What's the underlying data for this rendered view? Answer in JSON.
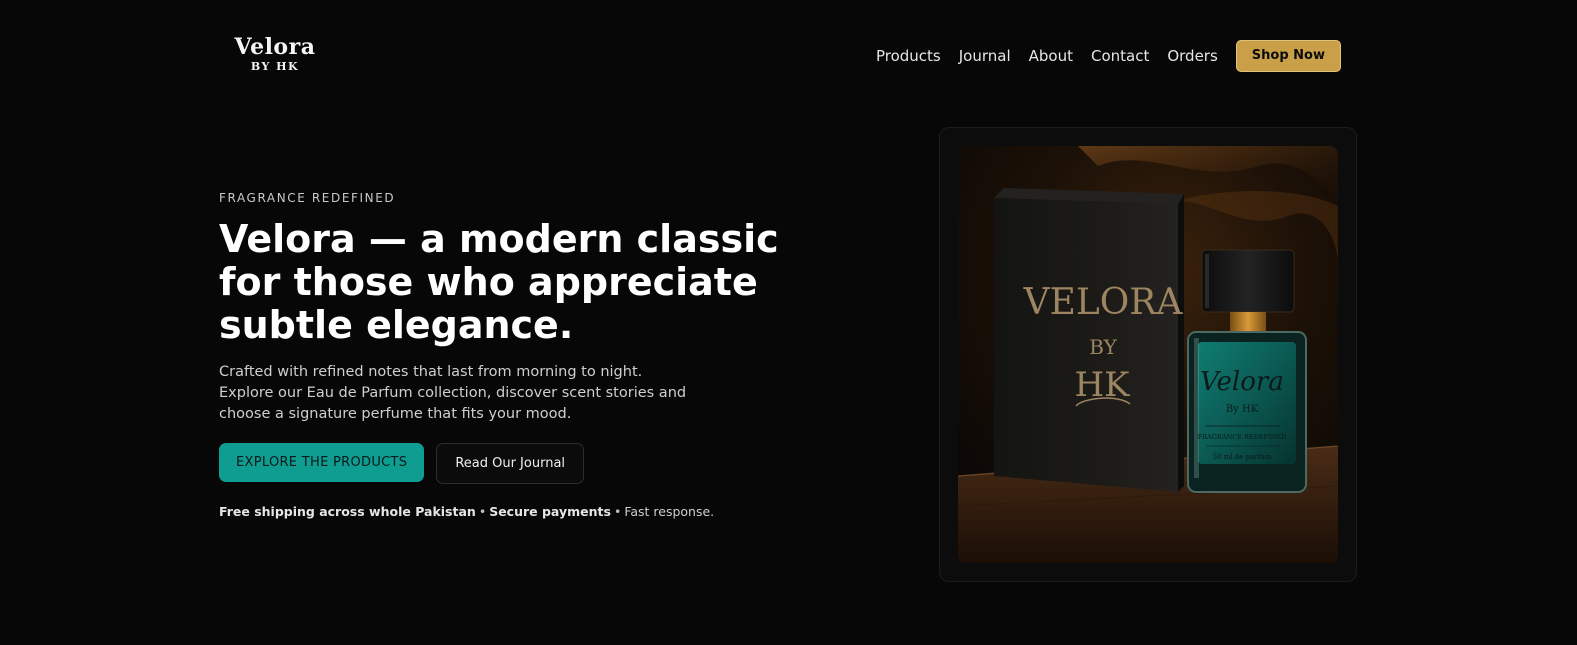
{
  "brand": {
    "name": "Velora",
    "tagline": "BY HK"
  },
  "nav": {
    "links": [
      "Products",
      "Journal",
      "About",
      "Contact",
      "Orders"
    ],
    "cta_label": "Shop Now"
  },
  "hero": {
    "eyebrow": "FRAGRANCE REDEFINED",
    "headline": "Velora — a modern classic for those who appreciate subtle elegance.",
    "description": "Crafted with refined notes that last from morning to night. Explore our Eau de Parfum collection, discover scent stories and choose a signature perfume that fits your mood.",
    "primary_cta": "EXPLORE THE PRODUCTS",
    "secondary_cta": "Read Our Journal",
    "perks": {
      "shipping": "Free shipping across whole Pakistan",
      "payments": "Secure payments",
      "response": "Fast response."
    }
  },
  "product_image": {
    "box_text": [
      "VELORA",
      "BY",
      "HK"
    ],
    "bottle_label": {
      "name": "Velora",
      "by": "By HK",
      "line": "FRAGRANCE REDEFINED",
      "volume": "50 ml de parfum"
    }
  },
  "colors": {
    "background": "#070707",
    "accent_gold": "#c9a048",
    "accent_teal": "#0f9d92"
  }
}
